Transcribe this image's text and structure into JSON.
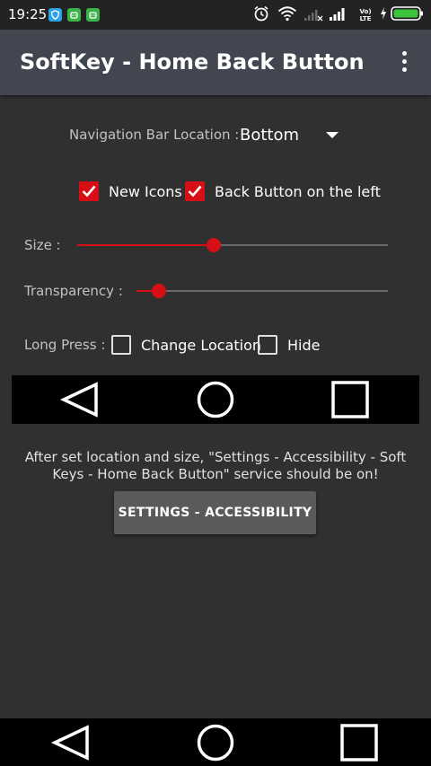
{
  "status_bar": {
    "time": "19:25",
    "volte_top": "Vo)",
    "volte_bottom": "LTE"
  },
  "app_bar": {
    "title": "SoftKey - Home Back Button"
  },
  "navigation_bar_location": {
    "label": "Navigation Bar Location :",
    "value": "Bottom"
  },
  "options": {
    "new_icons": {
      "label": "New Icons",
      "checked": true
    },
    "back_button_left": {
      "label": "Back Button on the left",
      "checked": true
    }
  },
  "size": {
    "label": "Size :",
    "value_fraction": 0.44
  },
  "transparency": {
    "label": "Transparency :",
    "value_fraction": 0.09
  },
  "long_press": {
    "label": "Long Press :",
    "change_location": {
      "label": "Change Location",
      "checked": false
    },
    "hide": {
      "label": "Hide",
      "checked": false
    }
  },
  "info_text": "After set location and size, \"Settings - Accessibility - Soft Keys - Home Back Button\" service should be on!",
  "settings_button": {
    "label": "SETTINGS - ACCESSIBILITY"
  },
  "colors": {
    "accent": "#d60f16",
    "background": "#303030",
    "app_bar": "#424651",
    "button": "#5a5a5a"
  },
  "icons": {
    "navigation": [
      "back-triangle-icon",
      "home-circle-icon",
      "recents-square-icon"
    ],
    "status": [
      "alarm-icon",
      "wifi-icon",
      "signal-icon",
      "battery-icon"
    ]
  }
}
